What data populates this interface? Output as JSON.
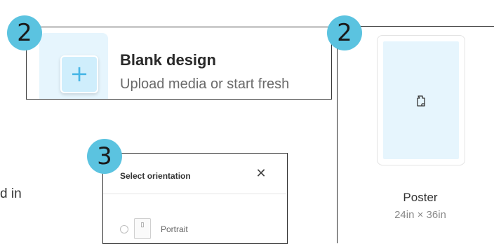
{
  "badges": {
    "blank": "2",
    "poster": "2",
    "orientation": "3"
  },
  "blank_design": {
    "icon": "plus-icon",
    "title": "Blank design",
    "subtitle": "Upload media or start fresh"
  },
  "poster": {
    "icon": "document-icon",
    "label": "Poster",
    "size": "24in × 36in"
  },
  "orientation_dialog": {
    "title": "Select orientation",
    "close_icon": "close-icon",
    "option_label": "Portrait"
  },
  "left_text": "d in",
  "colors": {
    "badge": "#5bc3e0",
    "thumb_bg": "#e6f5fd",
    "plus": "#47b6e6"
  }
}
